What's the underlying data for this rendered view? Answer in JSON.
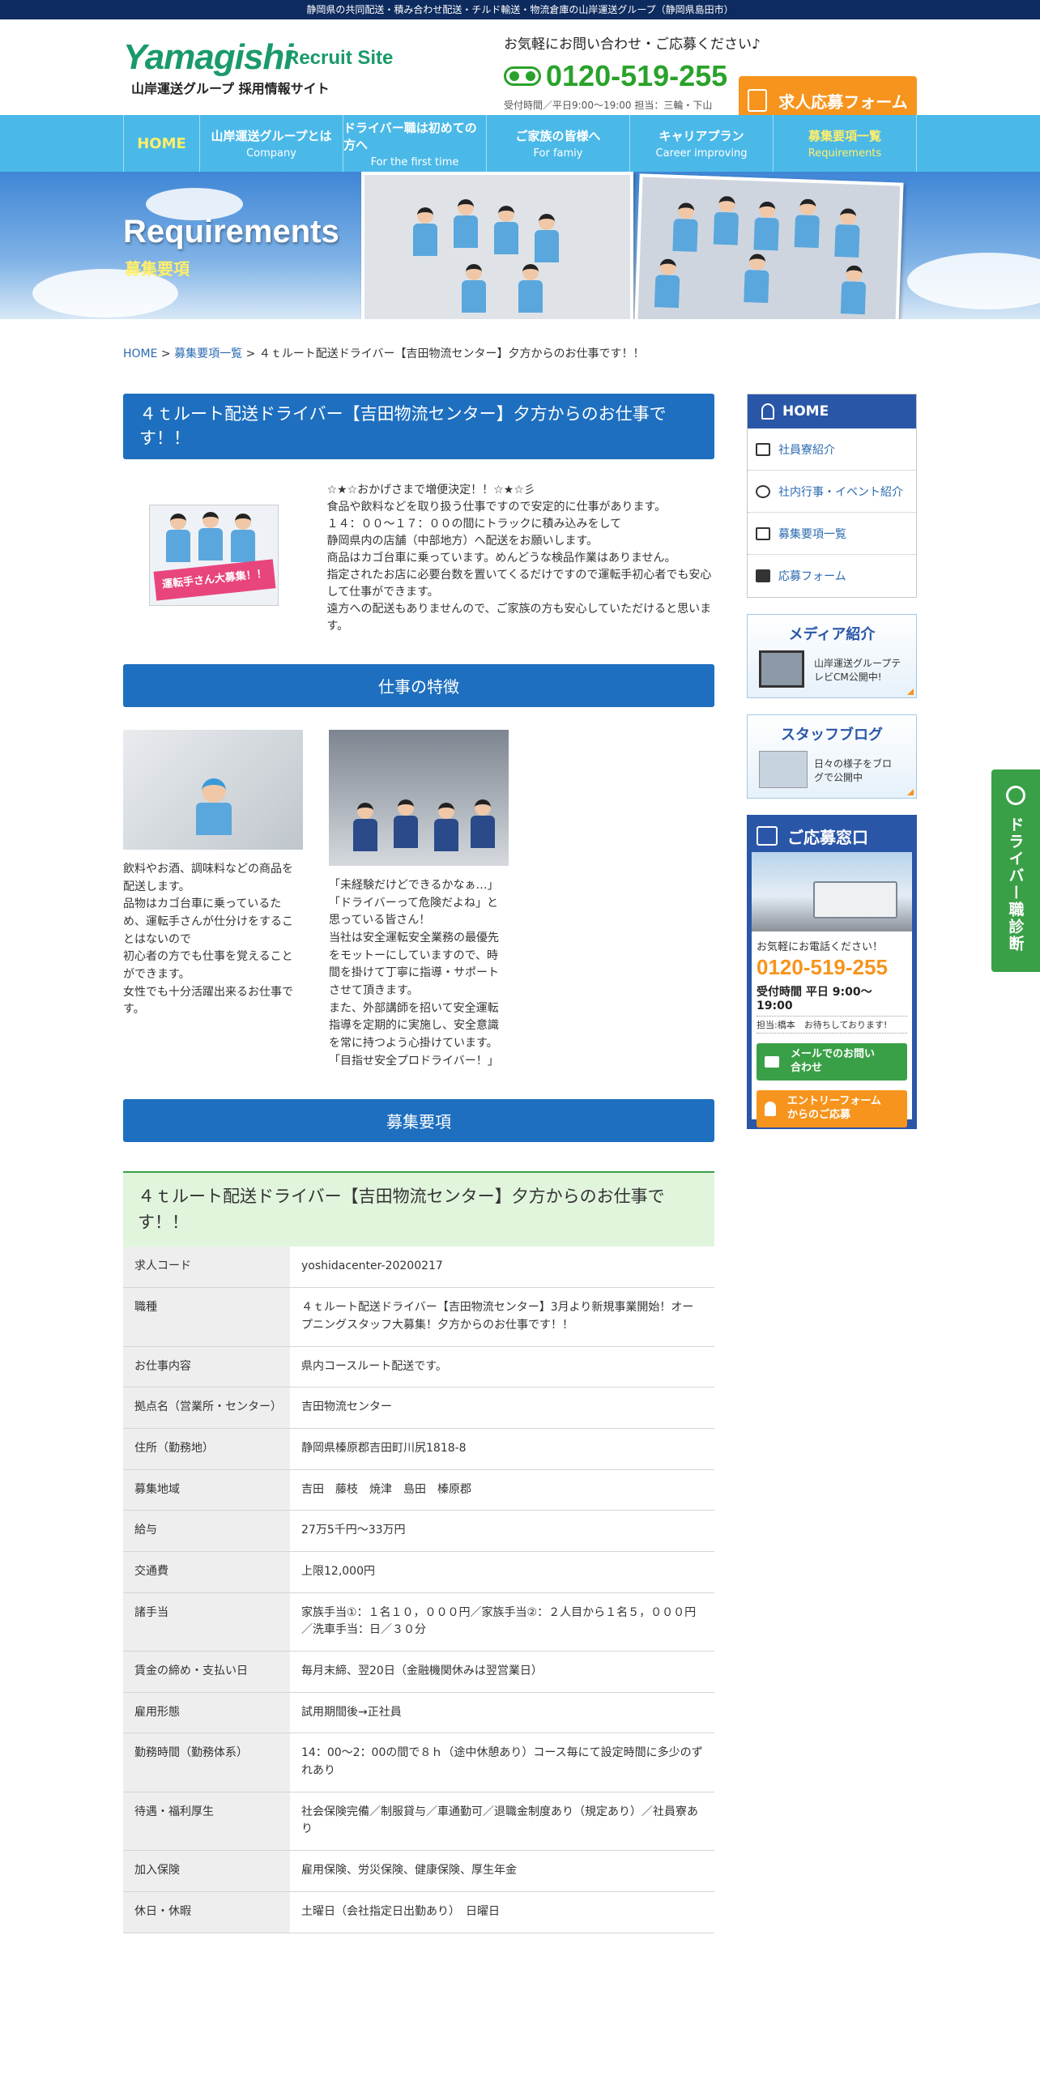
{
  "topbar": {
    "text": "静岡県の共同配送・積み合わせ配送・チルド輸送・物流倉庫の山岸運送グループ（静岡県島田市）"
  },
  "logo": {
    "main": "Yamagishi",
    "recruit": "Recruit Site",
    "caption": "山岸運送グループ 採用情報サイト"
  },
  "contact": {
    "lead": "お気軽にお問い合わせ・ご応募ください♪",
    "phone": "0120-519-255",
    "hours": "受付時間／平日9:00〜19:00 担当：三輪・下山"
  },
  "apply_button": {
    "label": "求人応募フォーム"
  },
  "nav": [
    {
      "jp": "HOME",
      "en": ""
    },
    {
      "jp": "山岸運送グループとは",
      "en": "Company"
    },
    {
      "jp": "ドライバー職は初めての方へ",
      "en": "For the first time"
    },
    {
      "jp": "ご家族の皆様へ",
      "en": "For famiy"
    },
    {
      "jp": "キャリアプラン",
      "en": "Career improving"
    },
    {
      "jp": "募集要項一覧",
      "en": "Requirements"
    }
  ],
  "hero": {
    "title": "Requirements",
    "subtitle": "募集要項"
  },
  "breadcrumb": {
    "home": "HOME",
    "sep1": " > ",
    "list": "募集要項一覧",
    "sep2": " > ",
    "current": "４ｔルート配送ドライバー【吉田物流センター】夕方からのお仕事です！！"
  },
  "main": {
    "title": "４ｔルート配送ドライバー【吉田物流センター】夕方からのお仕事です！！",
    "intro_banner": "運転手さん大募集！！",
    "intro_lines": [
      "☆★☆おかげさまで増便決定！！☆★☆彡",
      "食品や飲料などを取り扱う仕事ですので安定的に仕事があります。",
      "１４：００～１７：００の間にトラックに積み込みをして",
      "静岡県内の店舗（中部地方）へ配送をお願いします。",
      "商品はカゴ台車に乗っています。めんどうな検品作業はありません。",
      "指定されたお店に必要台数を置いてくるだけですので運転手初心者でも安心して仕事ができます。",
      "遠方への配送もありませんので、ご家族の方も安心していただけると思います。"
    ],
    "features_heading": "仕事の特徴",
    "features": [
      {
        "text": "飲料やお酒、調味料などの商品を配送します。\n品物はカゴ台車に乗っているため、運転手さんが仕分けをすることはないので\n初心者の方でも仕事を覚えることができます。\n女性でも十分活躍出来るお仕事です。"
      },
      {
        "text": "「未経験だけどできるかなぁ…」\n「ドライバーって危険だよね」と思っている皆さん！\n当社は安全運転安全業務の最優先をモットーにしていますので、時間を掛けて丁寧に指導・サポートさせて頂きます。\nまた、外部講師を招いて安全運転指導を定期的に実施し、安全意識を常に持つよう心掛けています。\n「目指せ安全プロドライバー！」"
      }
    ],
    "requirements_heading": "募集要項",
    "requirements_title": "４ｔルート配送ドライバー【吉田物流センター】夕方からのお仕事です！！",
    "requirements": [
      {
        "key": "求人コード",
        "value": "yoshidacenter-20200217"
      },
      {
        "key": "職種",
        "value": "４ｔルート配送ドライバー【吉田物流センター】3月より新規事業開始！オープニングスタッフ大募集！夕方からのお仕事です！！"
      },
      {
        "key": "お仕事内容",
        "value": "県内コースルート配送です。"
      },
      {
        "key": "拠点名（営業所・センター）",
        "value": "吉田物流センター"
      },
      {
        "key": "住所（勤務地）",
        "value": "静岡県榛原郡吉田町川尻1818-8"
      },
      {
        "key": "募集地域",
        "value": "吉田　藤枝　焼津　島田　榛原郡"
      },
      {
        "key": "給与",
        "value": "27万5千円～33万円"
      },
      {
        "key": "交通費",
        "value": "上限12,000円"
      },
      {
        "key": "諸手当",
        "value": "家族手当①：１名１０，０００円／家族手当②：２人目から１名５，０００円／洗車手当：日／３０分"
      },
      {
        "key": "賃金の締め・支払い日",
        "value": "毎月末締、翌20日（金融機関休みは翌営業日）"
      },
      {
        "key": "雇用形態",
        "value": "試用期間後→正社員"
      },
      {
        "key": "勤務時間（勤務体系）",
        "value": "14：00～2：00の間で８ｈ（途中休憩あり）コース毎にて設定時間に多少のずれあり"
      },
      {
        "key": "待遇・福利厚生",
        "value": "社会保険完備／制服貸与／車通勤可／退職金制度あり（規定あり）／社員寮あり"
      },
      {
        "key": "加入保険",
        "value": "雇用保険、労災保険、健康保険、厚生年金"
      },
      {
        "key": "休日・休暇",
        "value": "土曜日（会社指定日出勤あり）　日曜日"
      }
    ]
  },
  "sidebar": {
    "home": "HOME",
    "menu": [
      "社員寮紹介",
      "社内行事・イベント紹介",
      "募集要項一覧",
      "応募フォーム"
    ],
    "media": {
      "title": "メディア紹介",
      "text": "山岸運送グループテレビCM公開中!"
    },
    "blog": {
      "title": "スタッフブログ",
      "text": "日々の様子をブログで公開中"
    },
    "oubo": {
      "title": "ご応募窓口",
      "lead": "お気軽にお電話ください！",
      "phone": "0120-519-255",
      "hours": "受付時間 平日 9:00〜19:00",
      "note": "担当:橋本　お待ちしております!",
      "mail_btn": "メールでのお問い合わせ",
      "entry_btn": "エントリーフォームからのご応募"
    }
  },
  "side_tab": {
    "label": "ドライバー職診断"
  },
  "colors": {
    "nav": "#4bb9e8",
    "heading": "#1e6fbf",
    "accent_orange": "#f7941d",
    "accent_green": "#2aa22a",
    "sidebar_blue": "#2a56a8"
  }
}
